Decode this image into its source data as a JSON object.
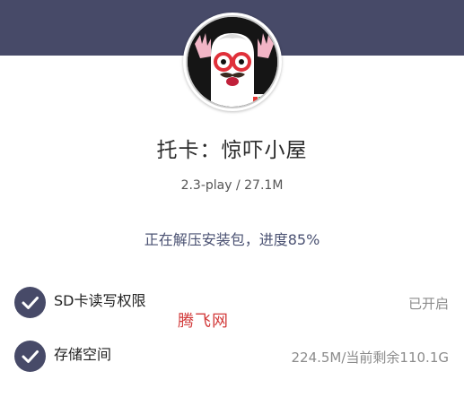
{
  "app": {
    "name": "托卡：惊吓小屋",
    "version_size": "2.3-play / 27.1M",
    "icon": "app-icon-cartoon-character"
  },
  "install": {
    "status_text": "正在解压安装包，进度85%",
    "progress_percent": 85
  },
  "permissions": [
    {
      "label": "SD卡读写权限",
      "value": "已开启",
      "icon": "check-circle-icon"
    },
    {
      "label": "存储空间",
      "value": "224.5M/当前剩余110.1G",
      "icon": "check-circle-icon"
    }
  ],
  "watermark": "腾飞网",
  "colors": {
    "banner": "#474a68",
    "check": "#474a68",
    "progress_text": "#4a5172",
    "watermark": "#d23a3a"
  }
}
